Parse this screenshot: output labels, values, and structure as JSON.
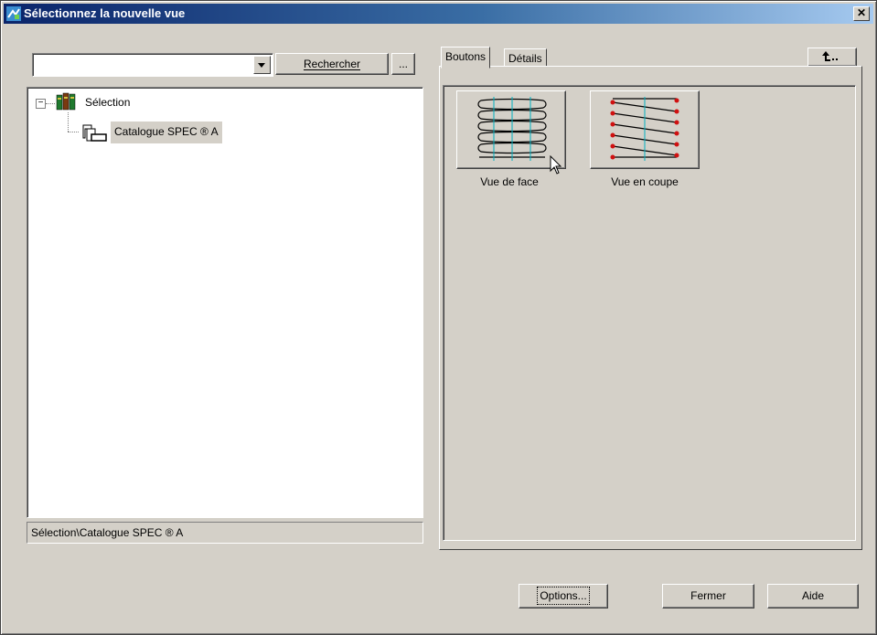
{
  "window": {
    "title": "Sélectionnez la nouvelle vue",
    "close_glyph": "✕"
  },
  "search": {
    "value": "",
    "search_button": "Rechercher",
    "browse_button": "..."
  },
  "tree": {
    "root": {
      "label": "Sélection",
      "expander": "−",
      "icon": "books-icon"
    },
    "child": {
      "label": "Catalogue SPEC ® A",
      "icon": "catalog-folder-icon"
    }
  },
  "status_path": "Sélection\\Catalogue SPEC ® A",
  "tabs": [
    {
      "label": "Boutons",
      "active": true
    },
    {
      "label": "Détails",
      "active": false
    }
  ],
  "views": [
    {
      "label": "Vue de face",
      "icon": "spring-front-view-icon"
    },
    {
      "label": "Vue en coupe",
      "icon": "spring-section-view-icon"
    }
  ],
  "footer": {
    "options": "Options...",
    "close": "Fermer",
    "help": "Aide"
  },
  "colors": {
    "title_start": "#0a246a",
    "title_end": "#a6caf0",
    "face": "#d4d0c8",
    "selection_bg": "#d4d0c8",
    "accent_red": "#d01010",
    "accent_cyan": "#00b0c0"
  }
}
